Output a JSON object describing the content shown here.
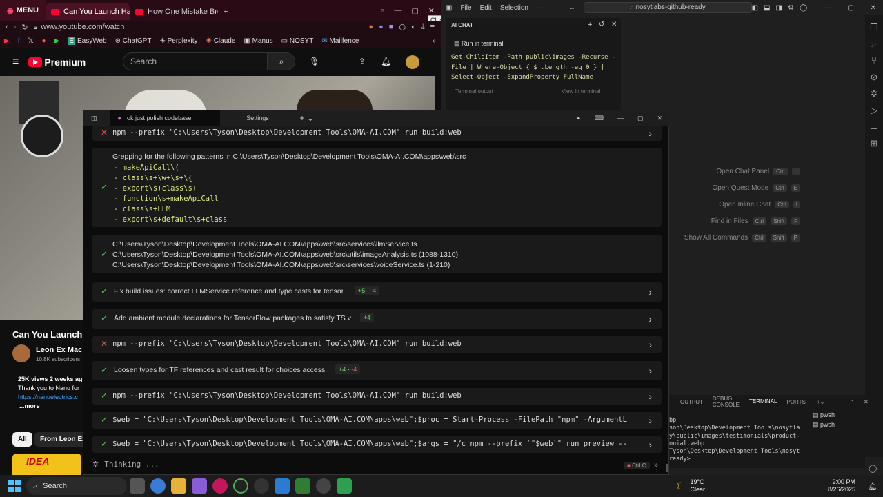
{
  "browser": {
    "menu_label": "MENU",
    "tabs": [
      {
        "title": "Can You Launch Hard"
      },
      {
        "title": "How One Mistake Broke C"
      }
    ],
    "close_tooltip": "Close",
    "url": "www.youtube.com/watch",
    "bookmarks": [
      "EasyWeb",
      "ChatGPT",
      "Perplexity",
      "Claude",
      "Manus",
      "NOSYT",
      "Mailfence"
    ],
    "yt": {
      "brand": "Premium",
      "search_placeholder": "Search",
      "video_title": "Can You Launch",
      "channel": "Leon Ex Mach",
      "subscribers": "10.8K subscribers",
      "views_line": "25K views  2 weeks ag",
      "desc_line": "Thank you to Nanu for",
      "link_line": "https://nanuelectrics.c",
      "more": "...more",
      "chip_all": "All",
      "chip_from": "From Leon Ex M",
      "thumb_text": "IDEA"
    },
    "colors": {
      "yt_red": "#ff0033",
      "tab_bg": "#2a0a14"
    }
  },
  "vscode": {
    "menus": [
      "File",
      "Edit",
      "Selection",
      "···"
    ],
    "search": "nosytlabs-github-ready",
    "chat": {
      "title": "AI CHAT",
      "run_label": "Run in terminal",
      "code": [
        "Get-ChildItem -Path public\\images -Recurse -",
        "File | Where-Object { $_.Length -eq 0 } |",
        "Select-Object -ExpandProperty FullName"
      ],
      "terminal_output": "Terminal output",
      "view_in_terminal": "View in terminal"
    },
    "commands": [
      {
        "label": "Open Chat Panel",
        "keys": [
          "Ctrl",
          "L"
        ]
      },
      {
        "label": "Open Quest Mode",
        "keys": [
          "Ctrl",
          "E"
        ]
      },
      {
        "label": "Open Inline Chat",
        "keys": [
          "Ctrl",
          "I"
        ]
      },
      {
        "label": "Find in Files",
        "keys": [
          "Ctrl",
          "Shift",
          "F"
        ]
      },
      {
        "label": "Show All Commands",
        "keys": [
          "Ctrl",
          "Shift",
          "P"
        ]
      }
    ],
    "terminal_tabs": [
      "OUTPUT",
      "DEBUG CONSOLE",
      "TERMINAL",
      "PORTS"
    ],
    "terminal_lines": [
      "bp",
      "son\\Desktop\\Development Tools\\nosytlabs-",
      "y\\public\\images\\testimonials\\product-man",
      "onial.webp",
      "Tyson\\Desktop\\Development Tools\\nosytla",
      "ready> "
    ],
    "shells": [
      "pwsh",
      "pwsh"
    ]
  },
  "terminal": {
    "tabs": [
      "ok just polish codebase",
      "Settings"
    ],
    "entries": [
      {
        "status": "fail",
        "text": "npm --prefix \"C:\\Users\\Tyson\\Desktop\\Development Tools\\OMA-AI.COM\" run build:web",
        "mono": true
      },
      {
        "status": "ok",
        "heading": "Grepping for the following patterns in C:\\Users\\Tyson\\Desktop\\Development Tools\\OMA-AI.COM\\apps\\web\\src",
        "patterns": [
          "- makeApiCall\\(",
          "- class\\s+\\w+\\s+\\{",
          "- export\\s+class\\s+",
          "- function\\s+makeApiCall",
          "- class\\s+LLM",
          "- export\\s+default\\s+class"
        ]
      },
      {
        "status": "ok",
        "files": [
          "C:\\Users\\Tyson\\Desktop\\Development Tools\\OMA-AI.COM\\apps\\web\\src\\services\\llmService.ts",
          "C:\\Users\\Tyson\\Desktop\\Development Tools\\OMA-AI.COM\\apps\\web\\src\\utils\\imageAnalysis.ts (1088-1310)",
          "C:\\Users\\Tyson\\Desktop\\Development Tools\\OMA-AI.COM\\apps\\web\\src\\services\\voiceService.ts (1-210)"
        ]
      },
      {
        "status": "ok",
        "text": "Fix build issues: correct LLMService reference and type casts for tensor",
        "add": "+5",
        "del": "-4"
      },
      {
        "status": "ok",
        "text": "Add ambient module declarations for TensorFlow packages to satisfy TS v",
        "add": "+4",
        "del": ""
      },
      {
        "status": "fail",
        "text": "npm --prefix \"C:\\Users\\Tyson\\Desktop\\Development Tools\\OMA-AI.COM\" run build:web",
        "mono": true
      },
      {
        "status": "ok",
        "text": "Loosen types for TF references and cast result for choices access",
        "add": "+4",
        "del": "-4"
      },
      {
        "status": "ok",
        "text": "npm --prefix \"C:\\Users\\Tyson\\Desktop\\Development Tools\\OMA-AI.COM\" run build:web",
        "mono": true
      },
      {
        "status": "ok",
        "text": "$web = \"C:\\Users\\Tyson\\Desktop\\Development Tools\\OMA-AI.COM\\apps\\web\";$proc = Start-Process -FilePath \"npm\" -ArgumentL",
        "mono": true
      },
      {
        "status": "ok",
        "text": "$web = \"C:\\Users\\Tyson\\Desktop\\Development Tools\\OMA-AI.COM\\apps\\web\";$args = \"/c npm --prefix `\"$web`\" run preview --",
        "mono": true
      }
    ],
    "thinking": "Thinking ...",
    "cancel": "Ctrl C"
  },
  "taskbar": {
    "search": "Search",
    "weather_temp": "19°C",
    "weather_desc": "Clear",
    "time": "9:00 PM",
    "date": "8/26/2025"
  }
}
